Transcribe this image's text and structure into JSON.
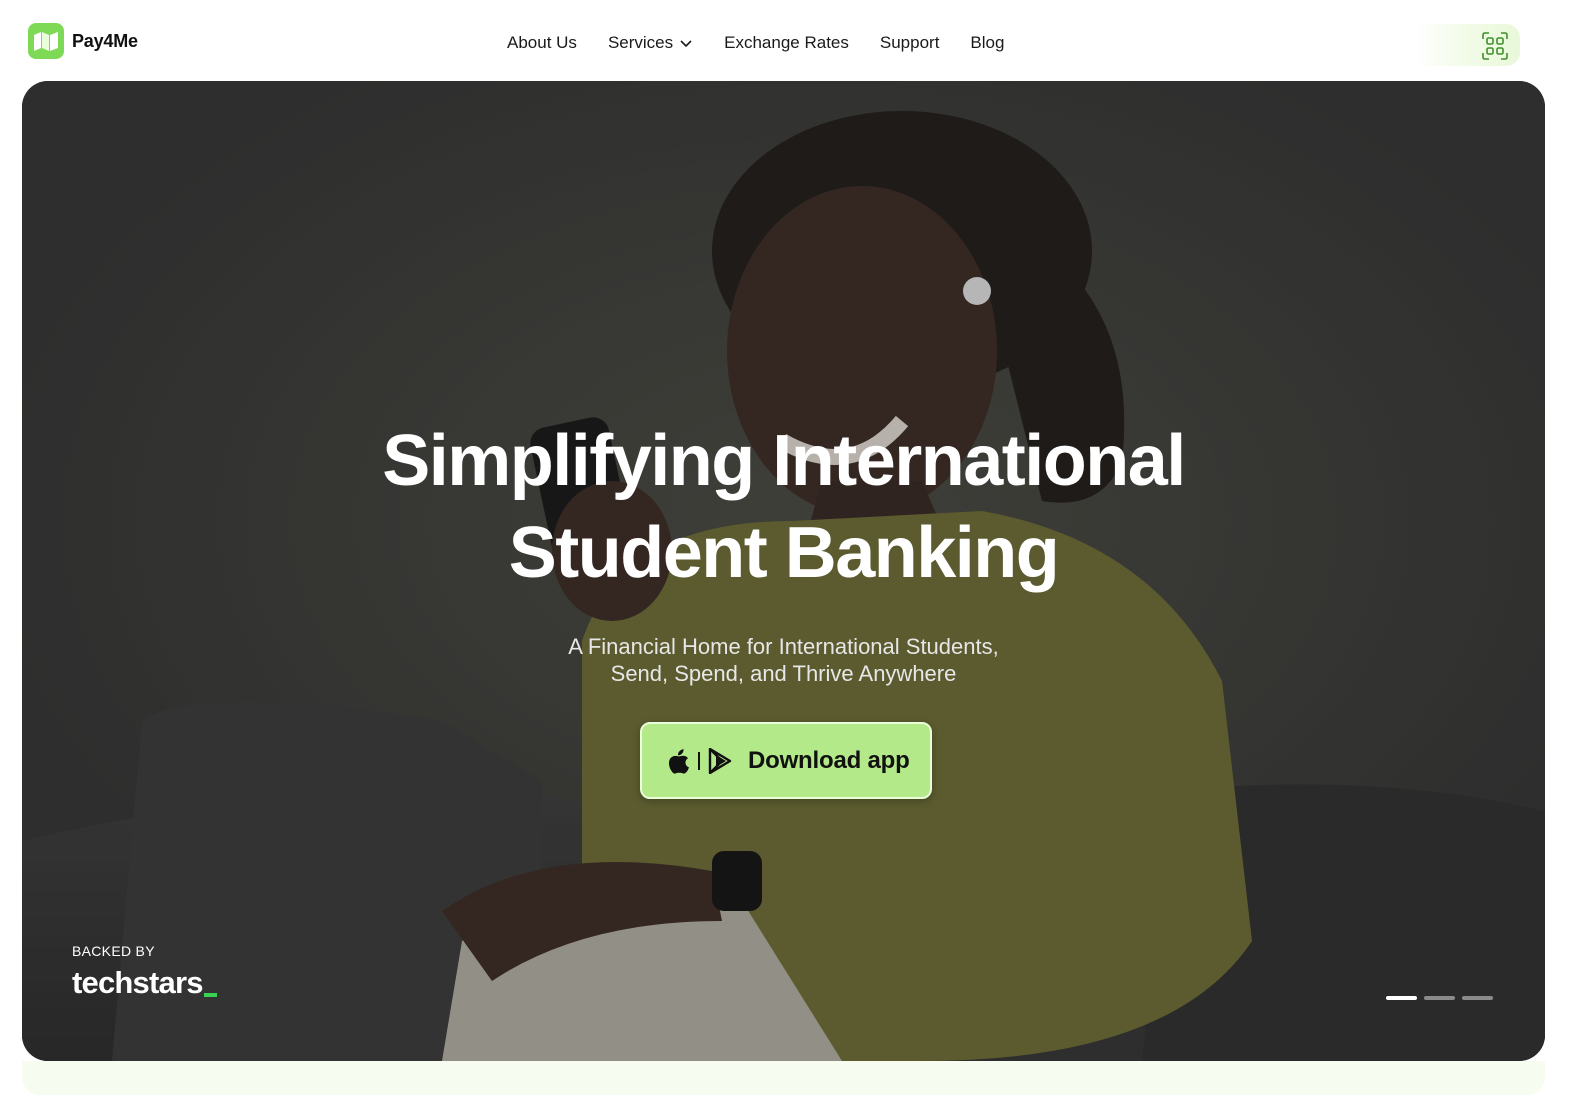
{
  "brand": {
    "name": "Pay4Me",
    "accent": "#7ed957"
  },
  "nav": {
    "items": [
      {
        "label": "About Us"
      },
      {
        "label": "Services",
        "has_dropdown": true
      },
      {
        "label": "Exchange Rates"
      },
      {
        "label": "Support"
      },
      {
        "label": "Blog"
      }
    ]
  },
  "header_action": {
    "icon": "qr-code-icon"
  },
  "hero": {
    "headline_line1": "Simplifying International",
    "headline_line2": "Student Banking",
    "subline_line1": "A Financial Home for International Students,",
    "subline_line2": "Send, Spend, and Thrive Anywhere",
    "cta": {
      "label": "Download app",
      "icons": [
        "apple-icon",
        "google-play-icon"
      ],
      "color": "#b4e98a"
    },
    "backed_by_label": "BACKED BY",
    "backer": "techstars",
    "carousel": {
      "slides": 3,
      "active_index": 0
    }
  }
}
